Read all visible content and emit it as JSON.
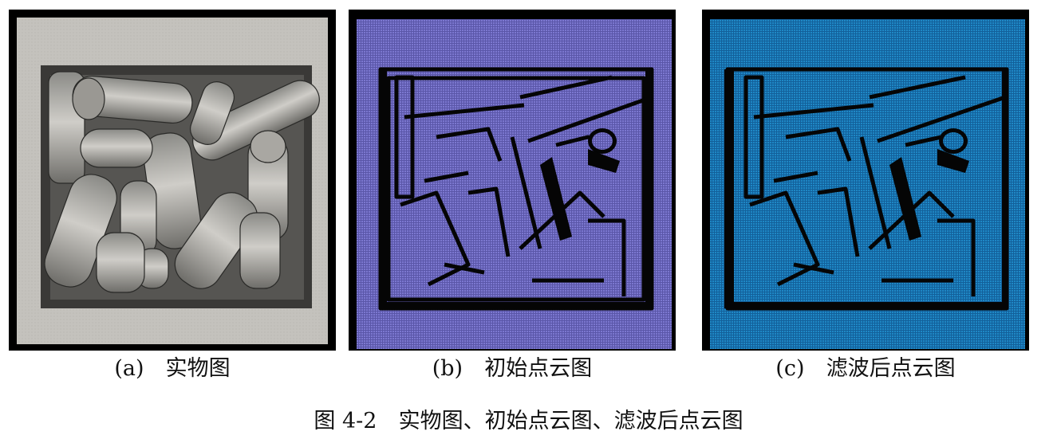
{
  "panels": [
    {
      "id": "a",
      "label": "(a)",
      "title": "实物图"
    },
    {
      "id": "b",
      "label": "(b)",
      "title": "初始点云图"
    },
    {
      "id": "c",
      "label": "(c)",
      "title": "滤波后点云图"
    }
  ],
  "caption": {
    "number": "图 4-2",
    "text": "实物图、初始点云图、滤波后点云图"
  },
  "colors": {
    "photo_bg": "#b9b7b2",
    "cloud_b": "#7672c9",
    "cloud_c": "#1d83c0",
    "frame": "#000000"
  }
}
